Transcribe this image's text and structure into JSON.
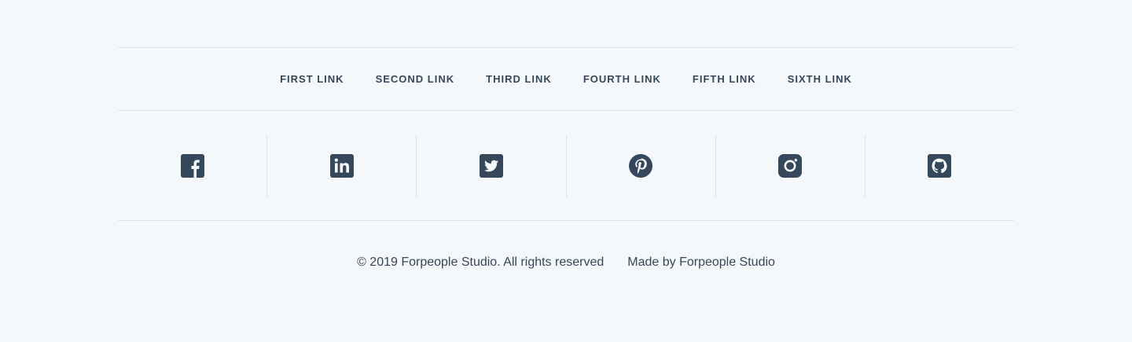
{
  "nav": {
    "links": [
      {
        "label": "FIRST LINK"
      },
      {
        "label": "SECOND LINK"
      },
      {
        "label": "THIRD LINK"
      },
      {
        "label": "FOURTH LINK"
      },
      {
        "label": "FIFTH LINK"
      },
      {
        "label": "SIXTH LINK"
      }
    ]
  },
  "social": {
    "icons": [
      "facebook-icon",
      "linkedin-icon",
      "twitter-icon",
      "pinterest-icon",
      "instagram-icon",
      "github-icon"
    ],
    "icon_color": "#35475a"
  },
  "footer": {
    "copyright": "© 2019 Forpeople Studio. All rights reserved",
    "made_by": "Made by Forpeople Studio"
  },
  "colors": {
    "background": "#f5f8fb",
    "text": "#35475a",
    "divider": "#dde3ea"
  }
}
